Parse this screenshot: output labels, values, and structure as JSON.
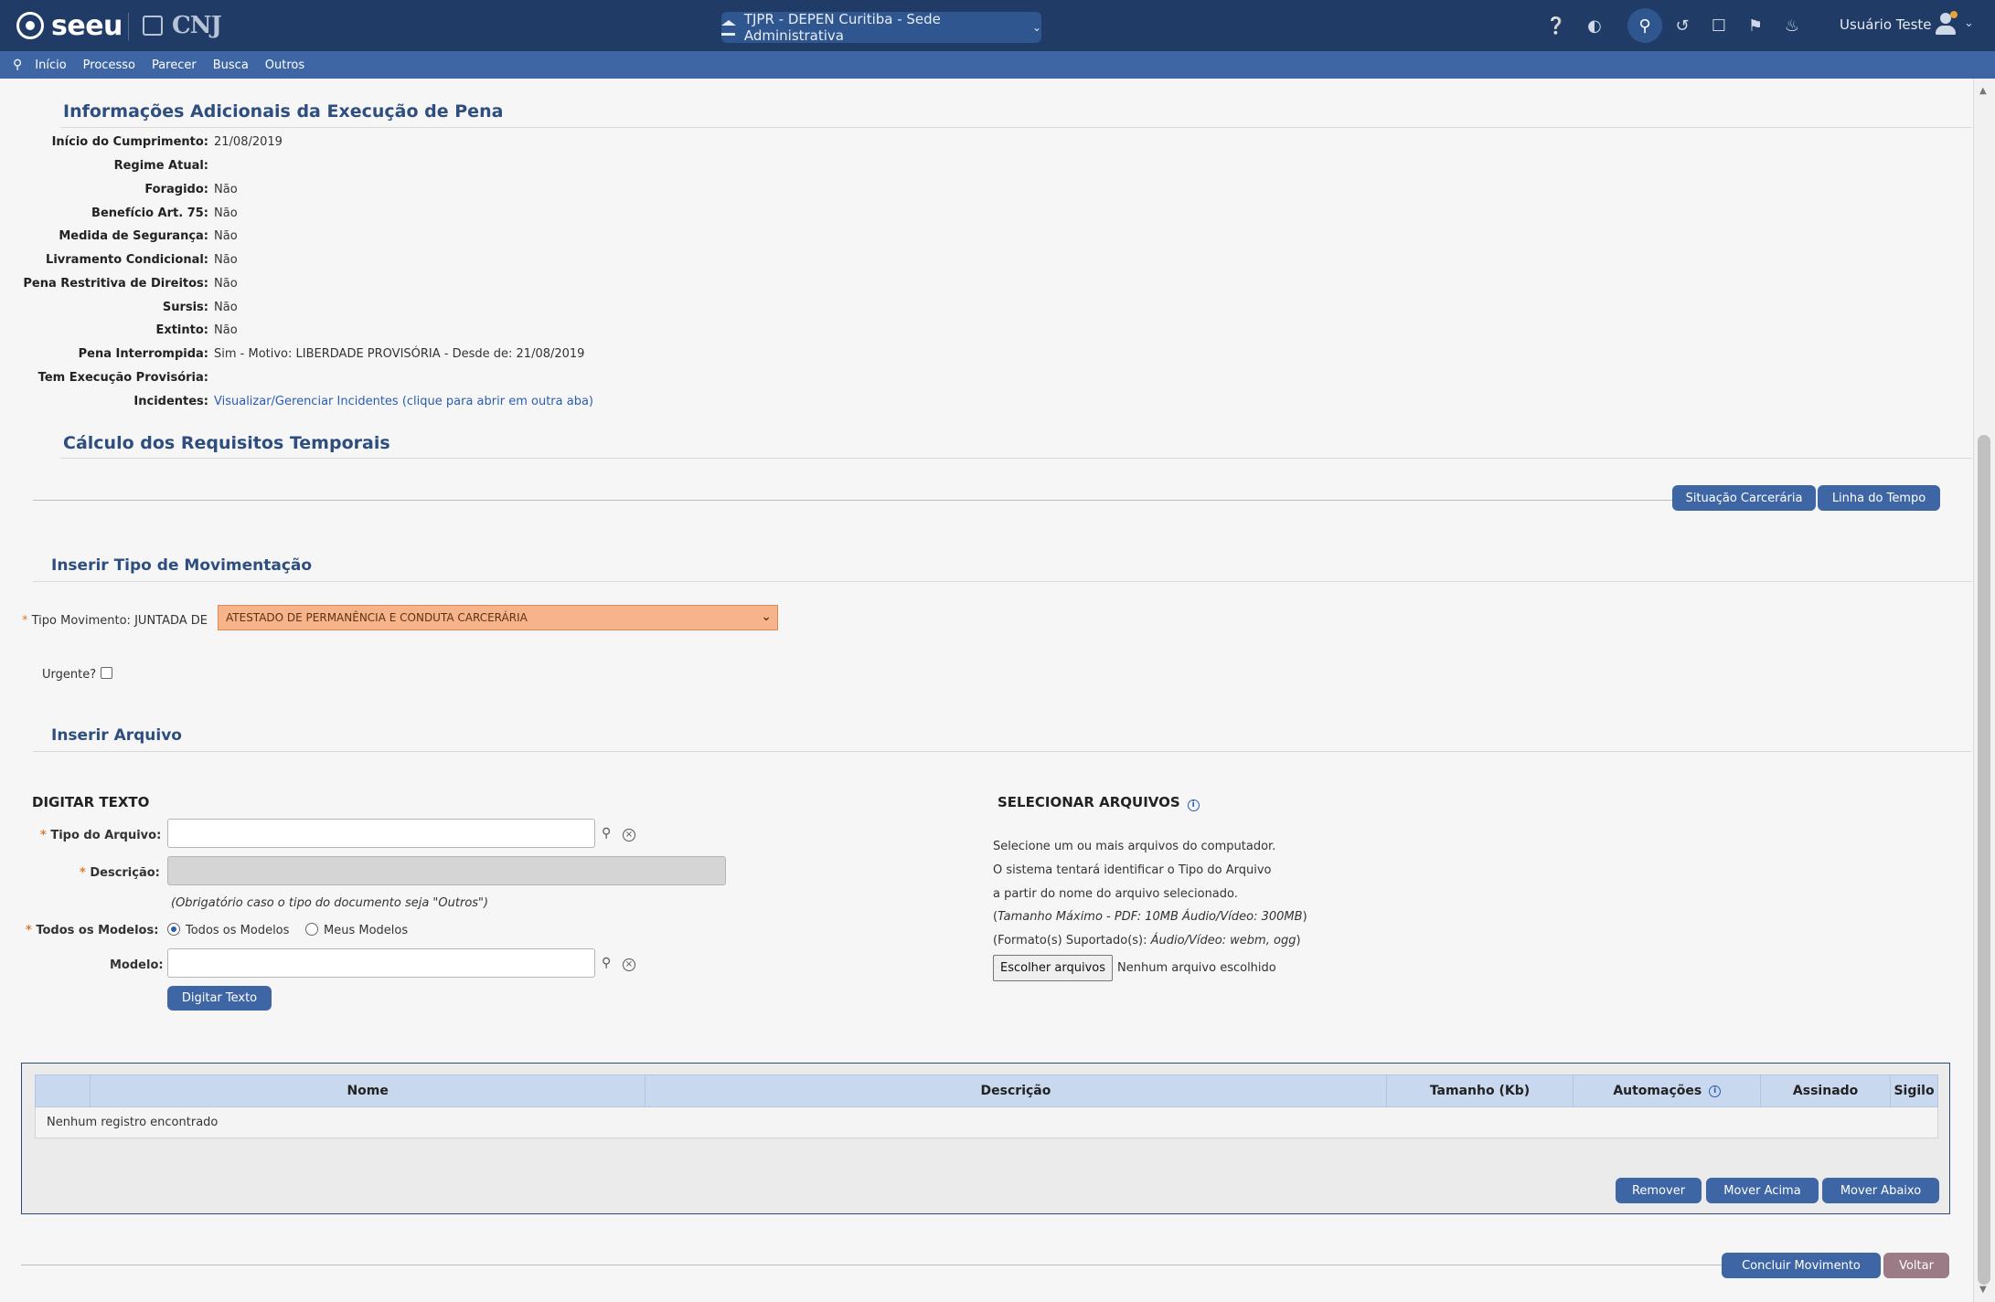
{
  "header": {
    "brand": "seeu",
    "partner": "CNJ",
    "court_selector": "TJPR - DEPEN Curitiba - Sede Administrativa",
    "user_name": "Usuário Teste"
  },
  "nav": {
    "items": [
      "Início",
      "Processo",
      "Parecer",
      "Busca",
      "Outros"
    ]
  },
  "info_section": {
    "title": "Informações Adicionais da Execução de Pena",
    "rows": [
      {
        "label": "Início do Cumprimento:",
        "value": "21/08/2019"
      },
      {
        "label": "Regime Atual:",
        "value": ""
      },
      {
        "label": "Foragido:",
        "value": "Não"
      },
      {
        "label": "Benefício Art. 75:",
        "value": "Não"
      },
      {
        "label": "Medida de Segurança:",
        "value": "Não"
      },
      {
        "label": "Livramento Condicional:",
        "value": "Não"
      },
      {
        "label": "Pena Restritiva de Direitos:",
        "value": "Não"
      },
      {
        "label": "Sursis:",
        "value": "Não"
      },
      {
        "label": "Extinto:",
        "value": "Não"
      },
      {
        "label": "Pena Interrompida:",
        "value": "Sim - Motivo: LIBERDADE PROVISÓRIA - Desde de: 21/08/2019"
      },
      {
        "label": "Tem Execução Provisória:",
        "value": ""
      },
      {
        "label": "Incidentes:",
        "value": "Visualizar/Gerenciar Incidentes (clique para abrir em outra aba)"
      }
    ]
  },
  "calc_section": {
    "title": "Cálculo dos Requisitos Temporais",
    "buttons": [
      "Situação Carcerária",
      "Linha do Tempo"
    ]
  },
  "mov_section": {
    "title": "Inserir Tipo de Movimentação",
    "label": "Tipo Movimento:",
    "prefix": "JUNTADA DE",
    "selected": "ATESTADO DE PERMANÊNCIA E CONDUTA CARCERÁRIA",
    "urgent_label": "Urgente?"
  },
  "file_section": {
    "title": "Inserir Arquivo",
    "digitar": {
      "heading": "DIGITAR TEXTO",
      "tipo_label": "Tipo do Arquivo:",
      "descricao_label": "Descrição:",
      "descricao_hint": "(Obrigatório caso o tipo do documento seja \"Outros\")",
      "modelos_label": "Todos os Modelos:",
      "radio_all": "Todos os Modelos",
      "radio_mine": "Meus Modelos",
      "modelo_label": "Modelo:",
      "button": "Digitar Texto"
    },
    "selecionar": {
      "heading": "SELECIONAR ARQUIVOS",
      "line1": "Selecione um ou mais arquivos do computador.",
      "line2": "O sistema tentará identificar o Tipo do Arquivo",
      "line3": "a partir do nome do arquivo selecionado.",
      "line4_prefix": "(",
      "line4_italic": "Tamanho Máximo - PDF: 10MB  Áudio/Vídeo: 300MB",
      "line4_suffix": ")",
      "line5_prefix": "(Formato(s) Suportado(s): ",
      "line5_italic": "Áudio/Vídeo: webm, ogg",
      "line5_suffix": ")",
      "choose_button": "Escolher arquivos",
      "no_file": "Nenhum arquivo escolhido"
    }
  },
  "table": {
    "columns": [
      "",
      "Nome",
      "Descrição",
      "Tamanho (Kb)",
      "Automações",
      "Assinado",
      "Sigilo"
    ],
    "empty": "Nenhum registro encontrado",
    "buttons": [
      "Remover",
      "Mover Acima",
      "Mover Abaixo"
    ]
  },
  "footer_buttons": {
    "conclude": "Concluir Movimento",
    "back": "Voltar"
  }
}
